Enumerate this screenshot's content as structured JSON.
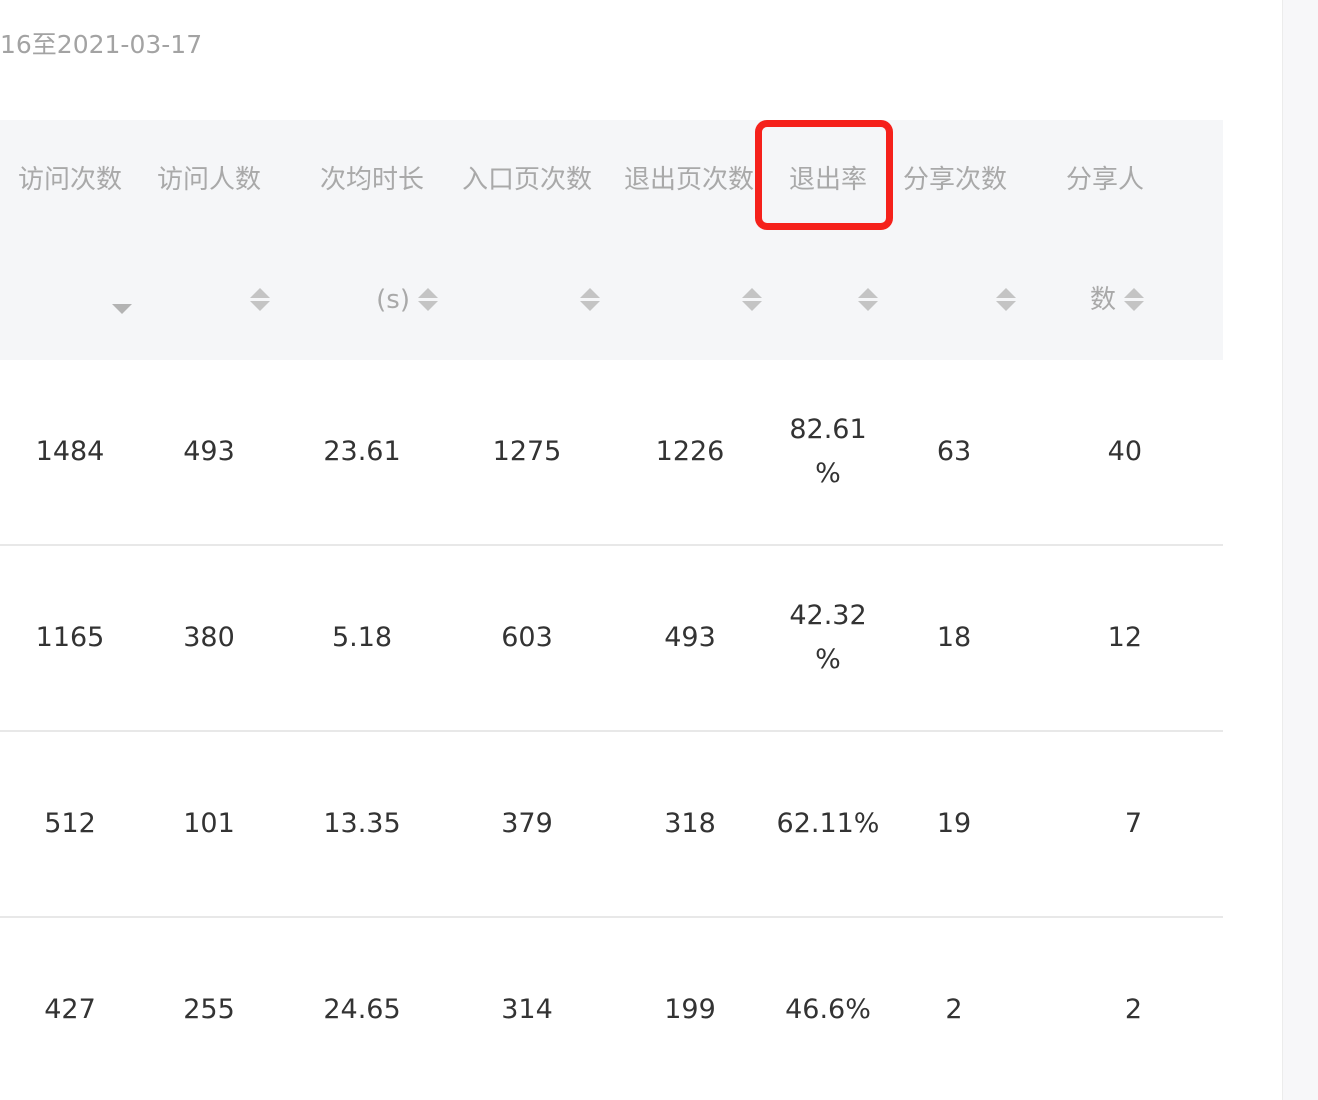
{
  "filter": {
    "date_range": "16至2021-03-17"
  },
  "table": {
    "columns": [
      {
        "key": "visits",
        "line1": "访问次数",
        "line2": "",
        "sort": "desc"
      },
      {
        "key": "visitors",
        "line1": "访问人数",
        "line2": "",
        "sort": "none"
      },
      {
        "key": "avg_time",
        "line1": "次均时长",
        "line2": "(s)",
        "sort": "none"
      },
      {
        "key": "entry_pages",
        "line1": "入口页次数",
        "line2": "",
        "sort": "none"
      },
      {
        "key": "exit_pages",
        "line1": "退出页次数",
        "line2": "",
        "sort": "none"
      },
      {
        "key": "exit_rate",
        "line1": "退出率",
        "line2": "",
        "sort": "none"
      },
      {
        "key": "shares",
        "line1": "分享次数",
        "line2": "",
        "sort": "none"
      },
      {
        "key": "sharers",
        "line1": "分享人",
        "line2": "数",
        "sort": "none"
      }
    ],
    "rows": [
      {
        "visits": "1484",
        "visitors": "493",
        "avg_time": "23.61",
        "entry_pages": "1275",
        "exit_pages": "1226",
        "exit_rate_l1": "82.61",
        "exit_rate_l2": "%",
        "shares": "63",
        "sharers": "40"
      },
      {
        "visits": "1165",
        "visitors": "380",
        "avg_time": "5.18",
        "entry_pages": "603",
        "exit_pages": "493",
        "exit_rate_l1": "42.32",
        "exit_rate_l2": "%",
        "shares": "18",
        "sharers": "12"
      },
      {
        "visits": "512",
        "visitors": "101",
        "avg_time": "13.35",
        "entry_pages": "379",
        "exit_pages": "318",
        "exit_rate_l1": "62.11%",
        "exit_rate_l2": "",
        "shares": "19",
        "sharers": "7"
      },
      {
        "visits": "427",
        "visitors": "255",
        "avg_time": "24.65",
        "entry_pages": "314",
        "exit_pages": "199",
        "exit_rate_l1": "46.6%",
        "exit_rate_l2": "",
        "shares": "2",
        "sharers": "2"
      }
    ]
  },
  "colors": {
    "highlight": "#f5211b",
    "header_bg": "#f5f6f8"
  }
}
